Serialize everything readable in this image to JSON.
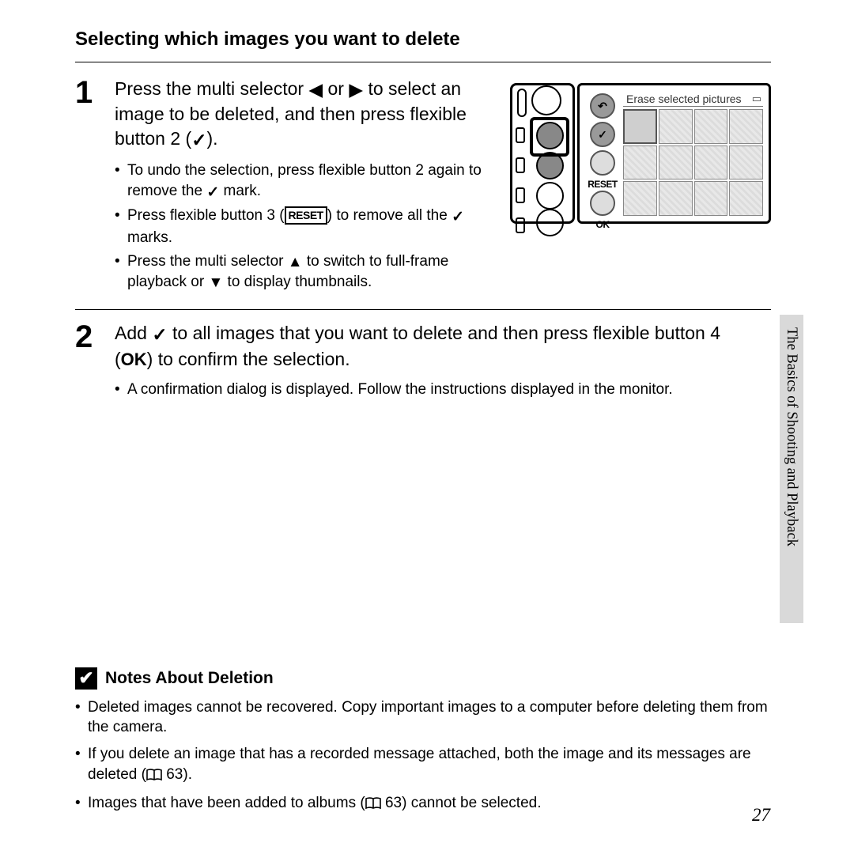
{
  "section_title": "Selecting which images you want to delete",
  "side_tab": "The Basics of Shooting and Playback",
  "page_number": "27",
  "step1": {
    "num": "1",
    "lead_a": "Press the multi selector ",
    "lead_b": " or ",
    "lead_c": " to select an image to be deleted, and then press flexible button 2 (",
    "lead_d": ").",
    "bullets": [
      {
        "a": "To undo the selection, press flexible button 2 again to remove the ",
        "b": " mark."
      },
      {
        "a": "Press flexible button 3 (",
        "b": ") to remove all the ",
        "c": " marks."
      },
      {
        "a": "Press the multi selector ",
        "b": " to switch to full-frame playback or ",
        "c": " to display thumbnails."
      }
    ]
  },
  "step2": {
    "num": "2",
    "lead_a": "Add ",
    "lead_b": " to all images that you want to delete and then press flexible button 4 (",
    "lead_c": ") to confirm the selection.",
    "bullet": "A confirmation dialog is displayed. Follow the instructions displayed in the monitor."
  },
  "notes": {
    "title": "Notes About Deletion",
    "items": [
      "Deleted images cannot be recovered. Copy important images to a computer before deleting them from the camera.",
      {
        "a": "If you delete an image that has a recorded message attached, both the image and its messages are deleted (",
        "b": " 63)."
      },
      {
        "a": "Images that have been added to albums (",
        "b": " 63) cannot be selected."
      }
    ]
  },
  "illustration": {
    "screen_title": "Erase selected pictures",
    "buttons": {
      "reset": "RESET",
      "ok": "OK"
    }
  },
  "labels": {
    "reset_inline": "RESET",
    "ok_inline": "OK"
  }
}
